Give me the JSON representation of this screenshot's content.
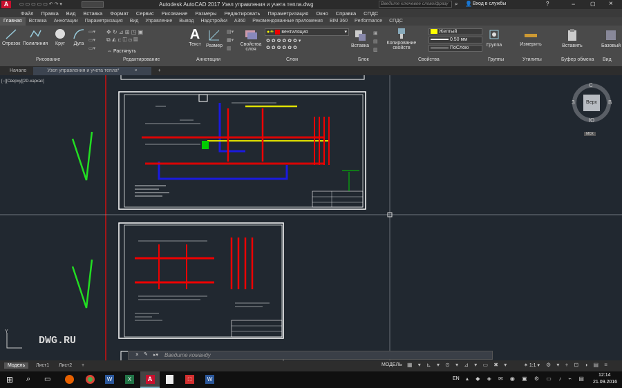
{
  "window": {
    "title": "Autodesk AutoCAD 2017    Узел управления и учета тепла.dwg",
    "search_placeholder": "Введите ключевое слово/фразу",
    "login": "Вход в службы"
  },
  "menu": [
    "Файл",
    "Правка",
    "Вид",
    "Вставка",
    "Формат",
    "Сервис",
    "Рисование",
    "Размеры",
    "Редактировать",
    "Параметризация",
    "Окно",
    "Справка",
    "СПДС"
  ],
  "ribbon_tabs": [
    "Главная",
    "Вставка",
    "Аннотации",
    "Параметризация",
    "Вид",
    "Управление",
    "Вывод",
    "Надстройки",
    "A360",
    "Рекомендованные приложения",
    "BIM 360",
    "Performance",
    "СПДС"
  ],
  "ribbon": {
    "draw": [
      "Отрезок",
      "Полилиния",
      "Круг",
      "Дуга"
    ],
    "draw_group": "Рисование",
    "stretch": "Растянуть",
    "edit_group": "Редактирование",
    "text": "Текст",
    "dimension": "Размер",
    "annot_group": "Аннотации",
    "layer_props": "Свойства слоя",
    "layer_name": "вентиляция",
    "layers_group": "Слои",
    "insert": "Вставка",
    "block_group": "Блок",
    "copy_props": "Копирование свойств",
    "color": "Желтый",
    "lineweight": "0.50 мм",
    "linetype": "ПоСлою",
    "props_group": "Свойства",
    "group": "Группа",
    "groups_group": "Группы",
    "measure": "Измерить",
    "utils_group": "Утилиты",
    "paste": "Вставить",
    "clipboard_group": "Буфер обмена",
    "base": "Базовый",
    "view_group": "Вид"
  },
  "doc_tabs": {
    "start": "Начало",
    "active": "Узел управления и учета тепла*"
  },
  "viewport": {
    "label": "[−][Сверху][2D-каркас]",
    "viewcube": {
      "top": "Верх",
      "n": "С",
      "s": "Ю",
      "w": "З",
      "e": "В",
      "wcs": "МСК"
    },
    "watermark": "DWG.RU",
    "command_placeholder": "Введите команду"
  },
  "layout_tabs": [
    "Модель",
    "Лист1",
    "Лист2"
  ],
  "status": {
    "model": "МОДЕЛЬ",
    "scale": "1:1"
  },
  "taskbar": {
    "lang": "EN",
    "time": "12:14",
    "date": "21.09.2016"
  },
  "colors": {
    "accent": "#c8102e",
    "viewport_bg": "#212830",
    "red_line": "#d01010",
    "check": "#22dd22"
  }
}
